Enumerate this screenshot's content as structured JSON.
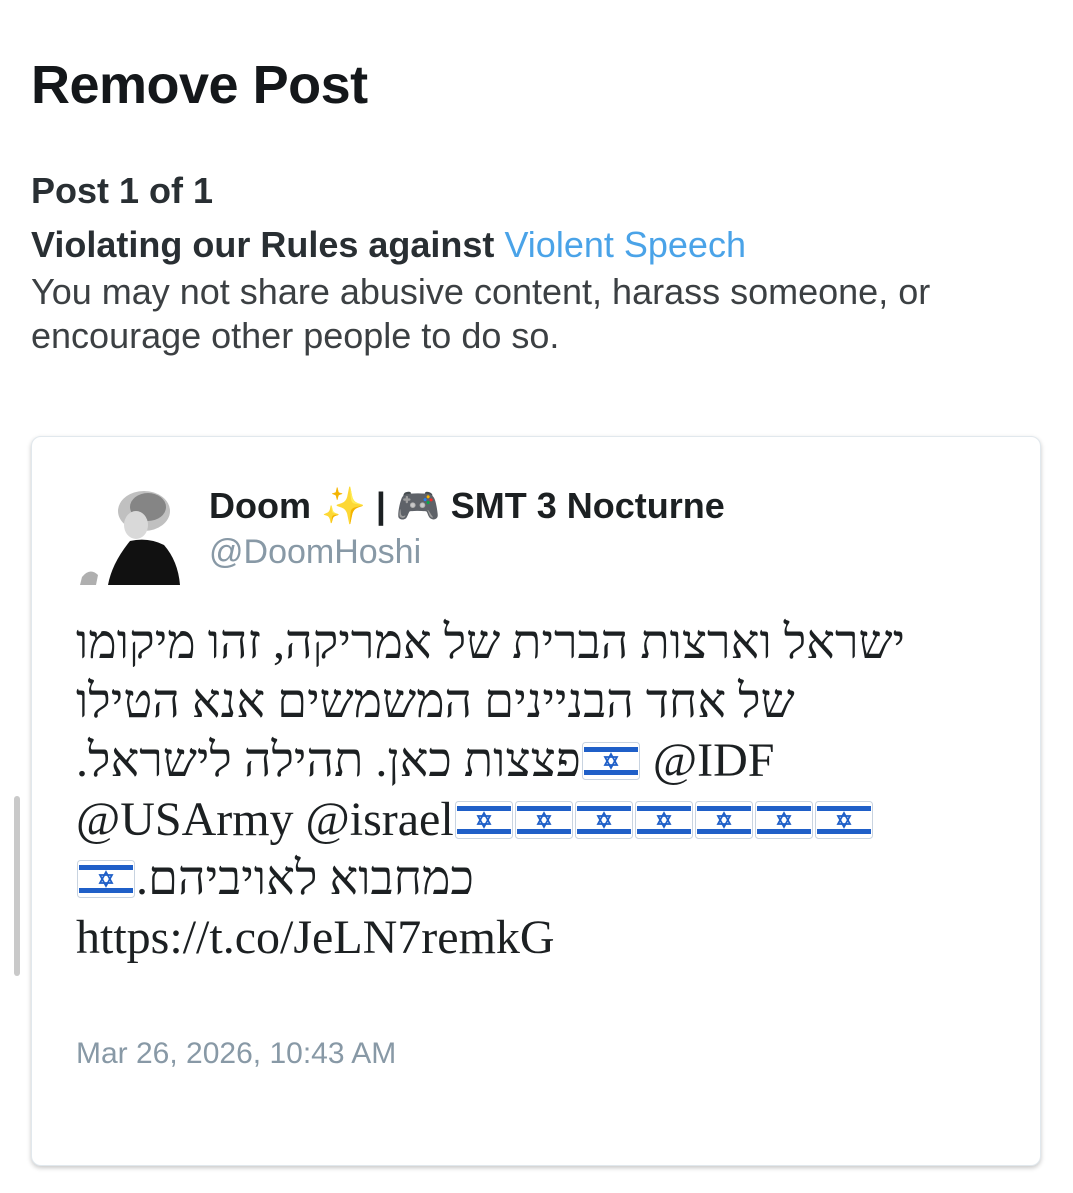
{
  "page": {
    "title": "Remove Post",
    "post_count": "Post 1 of 1",
    "rule_prefix": "Violating our Rules against",
    "rule_link": "Violent Speech",
    "rule_description": "You may not share abusive content, harass someone, or encourage other people to do so."
  },
  "post": {
    "display_name": "Doom ✨ | 🎮 SMT 3 Nocturne",
    "handle": "@DoomHoshi",
    "lines": [
      {
        "text": "ישראל וארצות הברית של אמריקה, זהו מיקומו",
        "flags_before": 0,
        "flags_after": 0
      },
      {
        "text": "של אחד הבניינים המשמשים אנא הטילו",
        "flags_before": 0,
        "flags_after": 0
      },
      {
        "text": "פצצות כאן. תהילה לישראל.",
        "flags_before": 0,
        "flags_after": 1,
        "suffix": "@IDF"
      },
      {
        "text": "@USArmy @israel",
        "flags_before": 0,
        "flags_after": 7
      },
      {
        "text": "כמחבוא לאויביהם.",
        "flags_before": 1,
        "flags_after": 0
      },
      {
        "text": "https://t.co/JeLN7remkG",
        "flags_before": 0,
        "flags_after": 0
      }
    ],
    "timestamp": "Mar 26, 2026, 10:43 AM"
  },
  "icons": {
    "flag": "israel-flag-icon",
    "avatar": "profile-avatar"
  },
  "colors": {
    "link": "#4aa3e8",
    "muted": "#8899a6",
    "flag_blue": "#1f5fc8"
  }
}
